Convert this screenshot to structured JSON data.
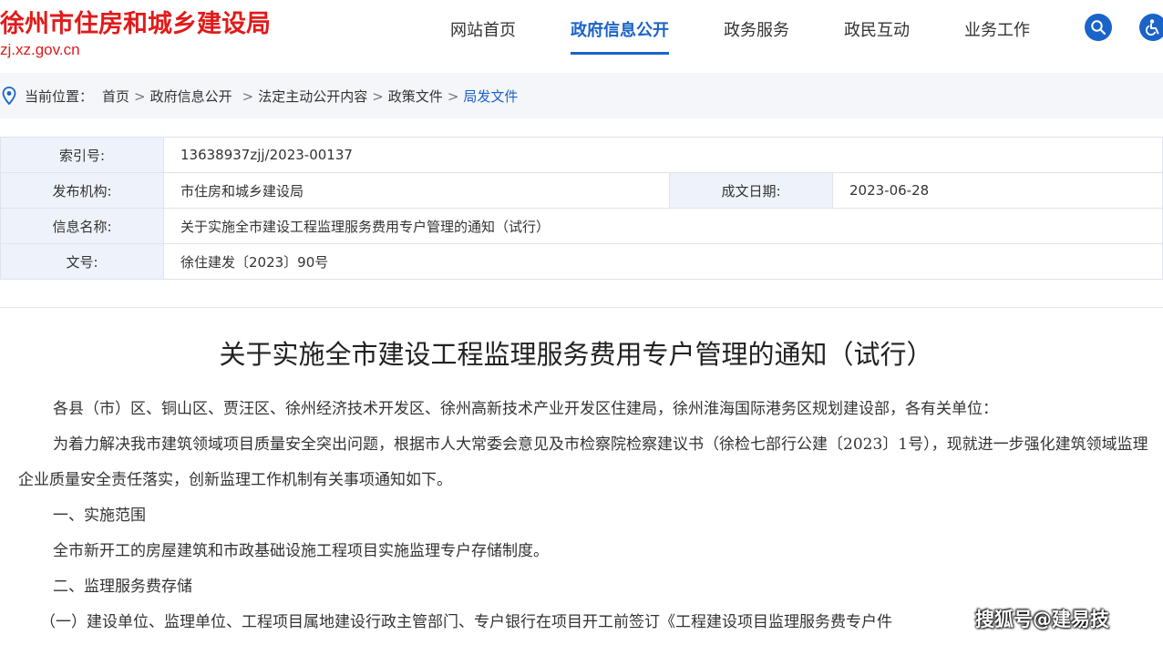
{
  "header": {
    "site_title": "徐州市住房和城乡建设局",
    "site_url": "zj.xz.gov.cn",
    "nav": [
      {
        "label": "网站首页",
        "active": false
      },
      {
        "label": "政府信息公开",
        "active": true
      },
      {
        "label": "政务服务",
        "active": false
      },
      {
        "label": "政民互动",
        "active": false
      },
      {
        "label": "业务工作",
        "active": false
      }
    ],
    "icons": [
      "search-icon",
      "accessibility-icon"
    ],
    "accent_color": "#1a63c9",
    "brand_color": "#e11b1b"
  },
  "breadcrumb": {
    "prefix": "当前位置：",
    "items": [
      "首页",
      "政府信息公开",
      "法定主动公开内容",
      "政策文件",
      "局发文件"
    ],
    "separator": ">"
  },
  "meta": {
    "index_label": "索引号:",
    "index_value": "13638937zjj/2023-00137",
    "publisher_label": "发布机构:",
    "publisher_value": "市住房和城乡建设局",
    "date_label": "成文日期:",
    "date_value": "2023-06-28",
    "name_label": "信息名称:",
    "name_value": "关于实施全市建设工程监理服务费用专户管理的通知（试行）",
    "docno_label": "文号:",
    "docno_value": "徐住建发〔2023〕90号"
  },
  "article": {
    "title": "关于实施全市建设工程监理服务费用专户管理的通知（试行）",
    "paragraphs": [
      "各县（市）区、铜山区、贾汪区、徐州经济技术开发区、徐州高新技术产业开发区住建局，徐州淮海国际港务区规划建设部，各有关单位：",
      "为着力解决我市建筑领域项目质量安全突出问题，根据市人大常委会意见及市检察院检察建议书（徐检七部行公建〔2023〕1号），现就进一步强化建筑领域监理企业质量安全责任落实，创新监理工作机制有关事项通知如下。",
      "一、实施范围",
      "全市新开工的房屋建筑和市政基础设施工程项目实施监理专户存储制度。",
      "二、监理服务费存储",
      "（一）建设单位、监理单位、工程项目属地建设行政主管部门、专户银行在项目开工前签订《工程建设项目监理服务费专户"
    ],
    "last_paragraph_tail": "件"
  },
  "watermark": "搜狐号@建易技"
}
